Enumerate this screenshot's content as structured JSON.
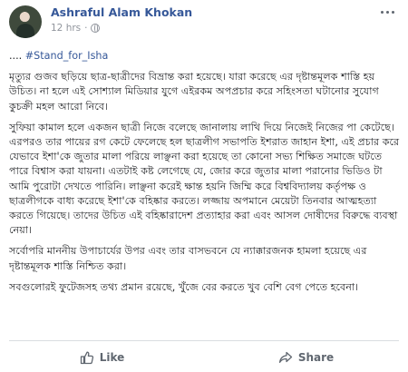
{
  "post": {
    "author": "Ashraful Alam Khokan",
    "timestamp": "12 hrs",
    "separator": "·",
    "hashtag_prefix": "....",
    "hashtag": "#Stand_for_Isha",
    "paragraphs": [
      "মৃত্যুর গুজব ছড়িয়ে ছাত্র-ছাত্রীদের বিভ্রান্ত করা হয়েছে। যারা করেছে এর দৃষ্টান্তমূলক শাস্তি হয় উচিত। না হলে এই সোশ্যাল মিডিয়ার যুগে এইরকম অপপ্রচার করে সহিংসতা ঘটানোর সুযোগ কুচক্রী মহল আরো নিবে।",
      "সুফিয়া কামাল হলে একজন ছাত্রী নিজে বলেছে জানালায় লাথি দিয়ে নিজেই নিজের পা কেটেছে। এরপরও তার পায়ের রগ কেটে ফেলেছে হল ছাত্রলীগ সভাপতি ইশরাত জাহান ইশা, এই প্রচার করে যেভাবে ইশা'কে জুতার মালা পরিয়ে লাঞ্ছনা করা হয়েছে তা কোনো সভ্য শিক্ষিত সমাজে ঘটতে পারে বিশ্বাস করা যায়না। এতটাই কষ্ট লেগেছে যে, জোর করে জুতার মালা পরানোর ভিডিও টা আমি পুরোটা দেখতে পারিনি। লাঞ্ছনা করেই ক্ষান্ত হয়নি জিম্মি করে বিশ্ববিদ্যালয় কর্তৃপক্ষ ও ছাত্রলীগকে বাধ্য করেছে ইশা'কে বহিষ্কার করতে। লজ্জায় অপমানে মেয়েটা তিনবার আত্মহত্যা করতে গিয়েছে। তাদের উচিত এই বহিষ্কারাদেশ প্রত্যাহার করা এবং আসল দোষীদের বিরুদ্ধে ব্যবস্থা নেয়া।",
      "সর্বোপরি মাননীয় উপাচার্যের উপর এবং তার বাসভবনে যে ন্যাক্কারজনক হামলা হয়েছে এর দৃষ্টান্তমূলক শাস্তি নিশ্চিত করা।",
      "সবগুলোরই ফুটেজসহ তথ্য প্রমান রয়েছে, খুঁজে বের করতে খুব বেশি বেগ পেতে হবেনা।"
    ]
  },
  "actions": {
    "like_label": "Like",
    "share_label": "Share"
  },
  "icons": {
    "avatar": "profile-photo",
    "privacy": "globe-icon",
    "options": "more-options-icon",
    "like": "thumbs-up-icon",
    "share": "share-arrow-icon"
  },
  "colors": {
    "link": "#365899",
    "meta": "#90949c",
    "action": "#606770",
    "divider": "#dadde1"
  }
}
